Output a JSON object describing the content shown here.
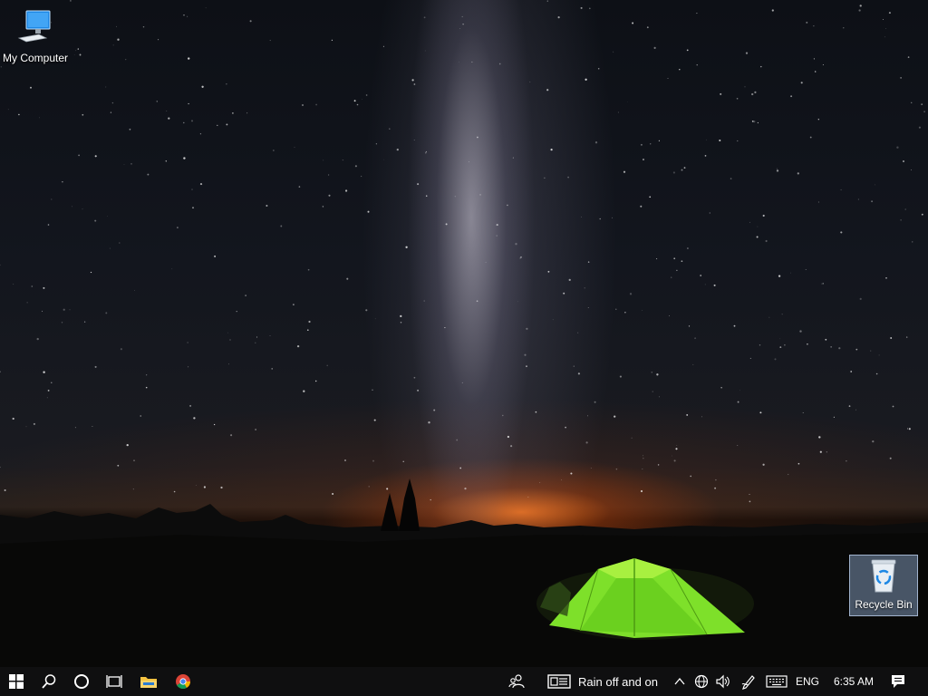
{
  "desktop": {
    "icons": [
      {
        "label": "My Computer",
        "icon": "computer-icon"
      },
      {
        "label": "Recycle Bin",
        "icon": "recycle-bin-icon"
      }
    ],
    "wallpaper": "night-sky-milky-way-tent"
  },
  "taskbar": {
    "pinned": [
      {
        "name": "start-button",
        "icon": "windows-logo-icon"
      },
      {
        "name": "search-button",
        "icon": "search-icon"
      },
      {
        "name": "cortana-button",
        "icon": "cortana-circle-icon"
      },
      {
        "name": "task-view-button",
        "icon": "task-view-icon"
      },
      {
        "name": "file-explorer-button",
        "icon": "folder-icon"
      },
      {
        "name": "chrome-button",
        "icon": "chrome-icon"
      }
    ],
    "tray": {
      "weather_text": "Rain off and on",
      "language": "ENG",
      "time": "6:35 AM"
    }
  },
  "colors": {
    "taskbar_bg": "#0f0f10",
    "tent_green": "#7ee02a",
    "horizon_orange": "#ff7a1e"
  }
}
